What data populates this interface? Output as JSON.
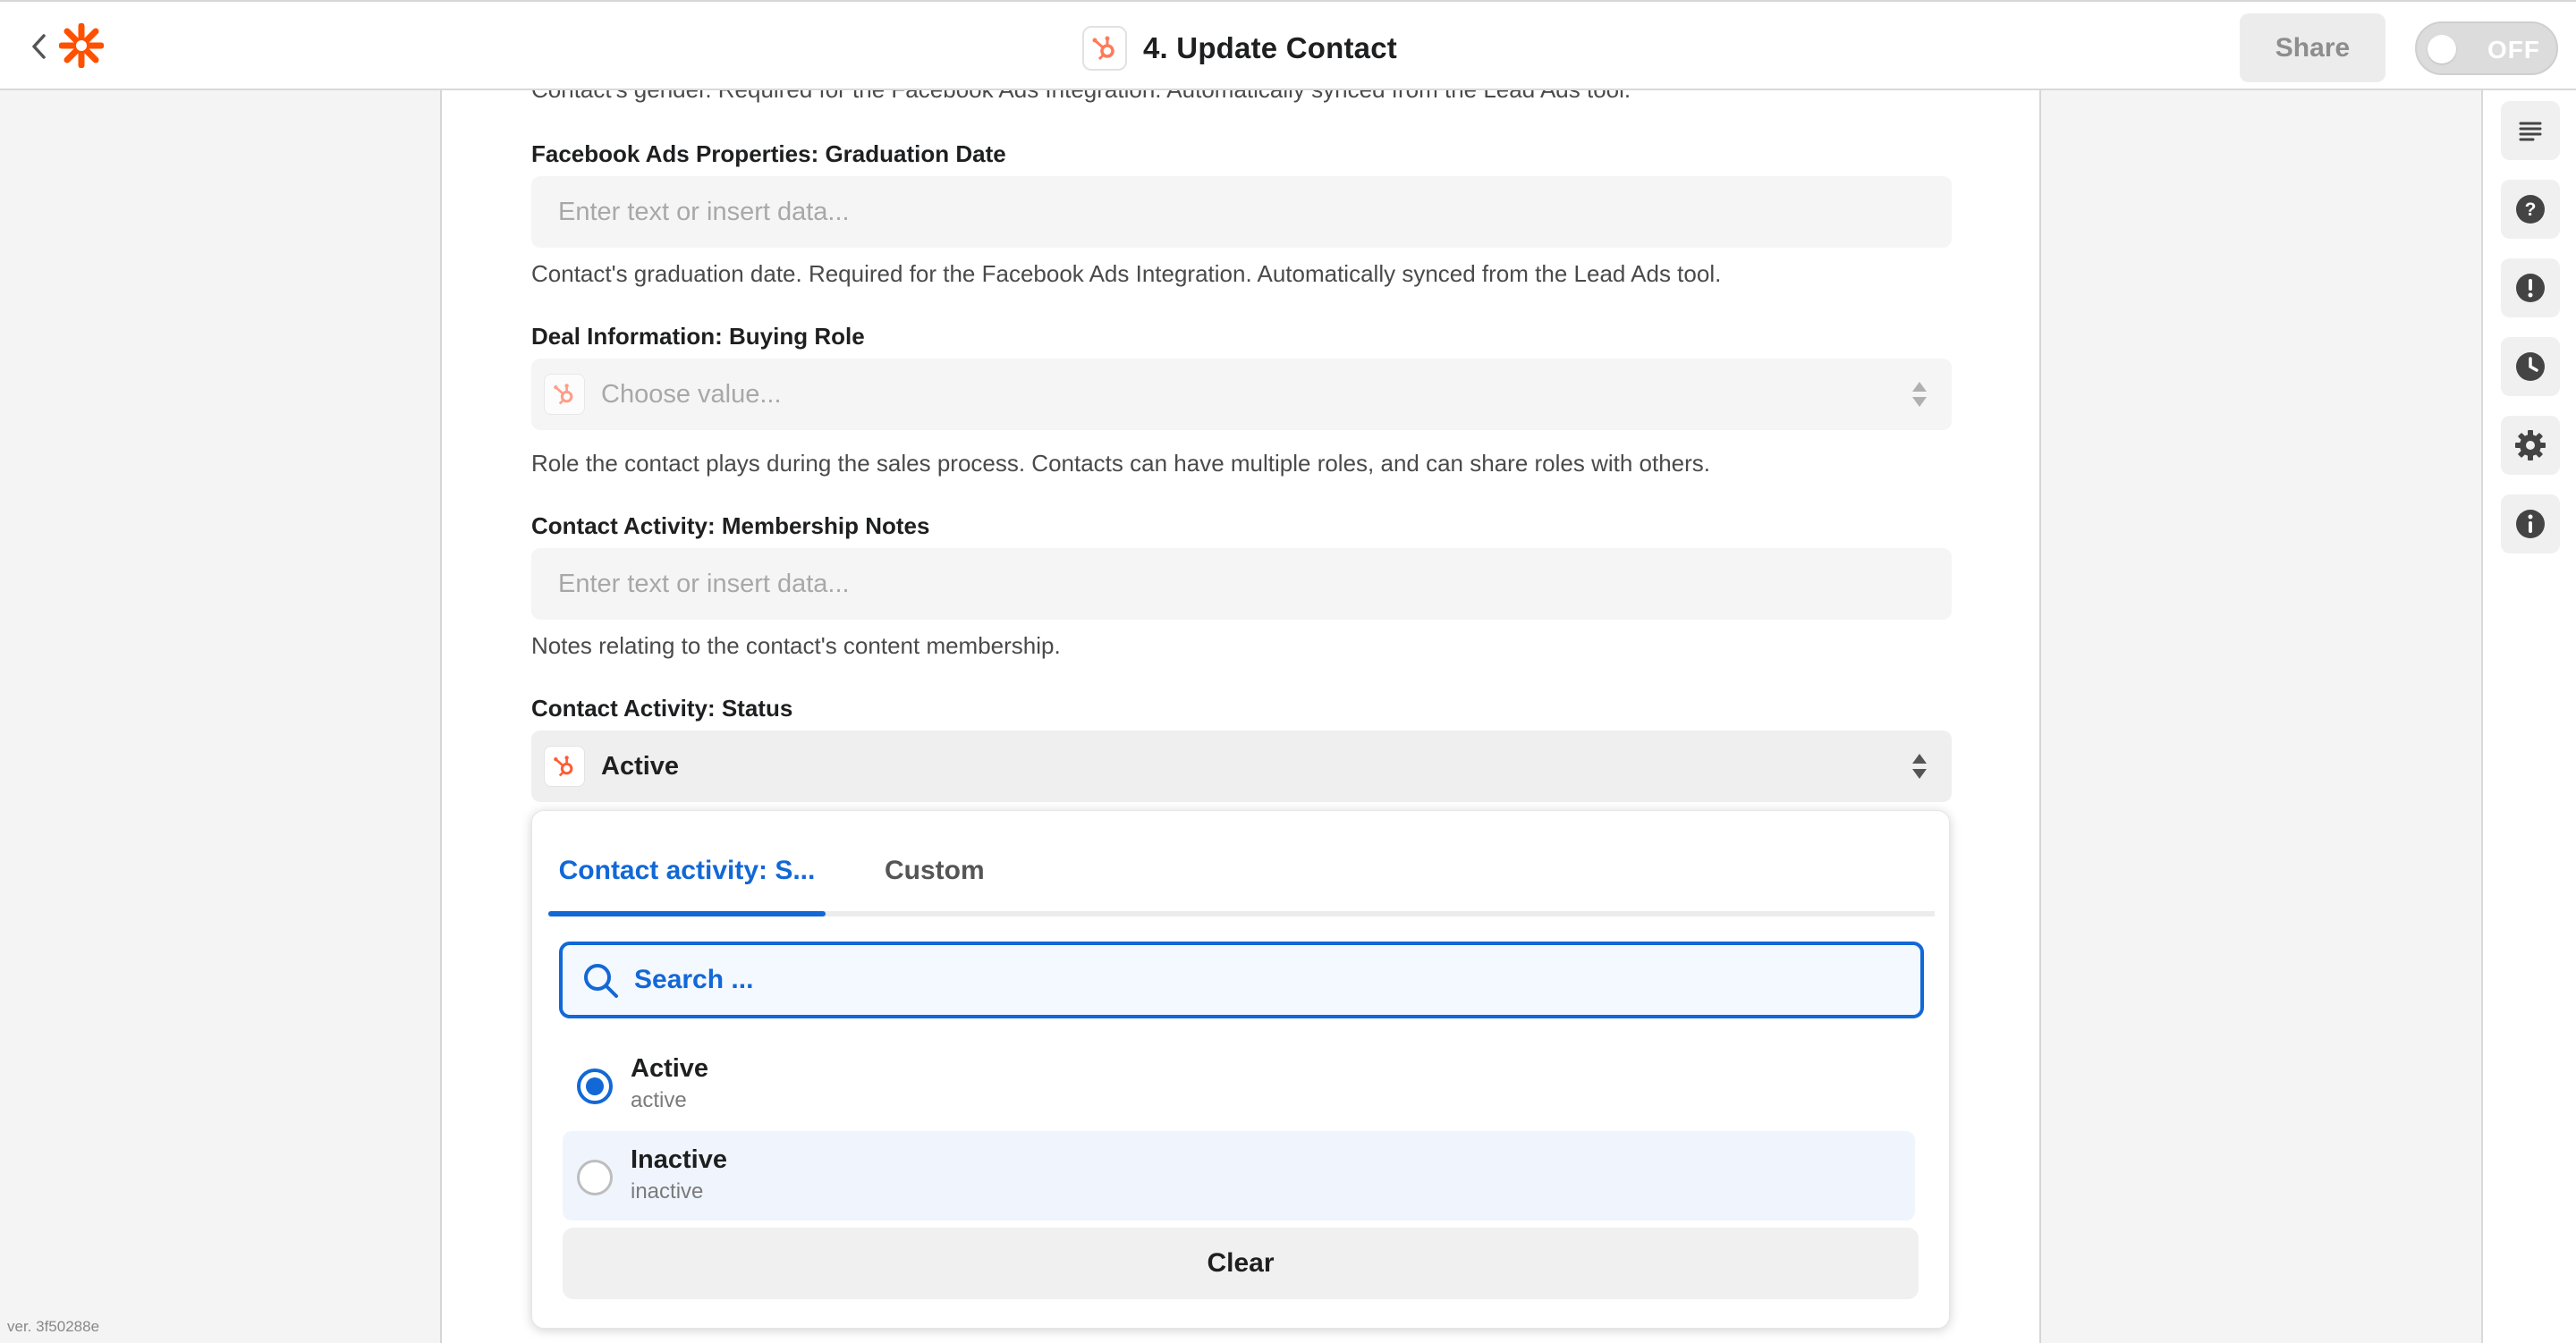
{
  "header": {
    "title": "4. Update Contact",
    "share_label": "Share",
    "toggle_label": "OFF"
  },
  "form": {
    "cut_help_text": "Contact's gender. Required for the Facebook Ads Integration. Automatically synced from the Lead Ads tool.",
    "fields": [
      {
        "label": "Facebook Ads Properties: Graduation Date",
        "placeholder": "Enter text or insert data...",
        "help": "Contact's graduation date. Required for the Facebook Ads Integration. Automatically synced from the Lead Ads tool."
      },
      {
        "label": "Deal Information: Buying Role",
        "placeholder": "Choose value...",
        "help": "Role the contact plays during the sales process. Contacts can have multiple roles, and can share roles with others."
      },
      {
        "label": "Contact Activity: Membership Notes",
        "placeholder": "Enter text or insert data...",
        "help": "Notes relating to the contact's content membership."
      },
      {
        "label": "Contact Activity: Status",
        "value": "Active"
      }
    ]
  },
  "dropdown": {
    "tabs": [
      "Contact activity: S...",
      "Custom"
    ],
    "search_placeholder": "Search ...",
    "options": [
      {
        "label": "Active",
        "sub": "active",
        "checked": true
      },
      {
        "label": "Inactive",
        "sub": "inactive",
        "checked": false
      }
    ],
    "clear_label": "Clear"
  },
  "footer": {
    "version": "ver. 3f50288e"
  },
  "colors": {
    "accent_blue": "#1268d6",
    "zapier_orange": "#ff4f00",
    "hubspot_orange": "#ff7a59"
  },
  "icons": [
    "back-chevron-icon",
    "zapier-logo-icon",
    "hubspot-icon",
    "outline-icon",
    "help-icon",
    "alert-icon",
    "history-icon",
    "gear-icon",
    "info-icon",
    "search-icon",
    "sort-arrows-icon"
  ]
}
